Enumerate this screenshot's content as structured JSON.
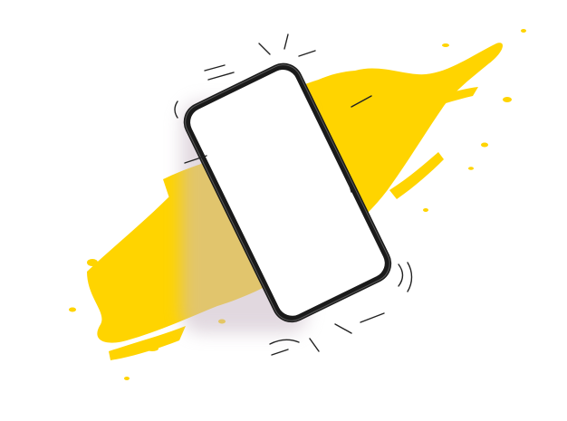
{
  "colors": {
    "background": "#ffffff",
    "splash": "#FFD400",
    "phone_frame": "#1a1a1a",
    "phone_screen": "#ffffff",
    "motion_lines": "#222222",
    "shadow": "#c9b9c6"
  },
  "icons": {
    "splash": "yellow-paint-brush-stroke",
    "device": "smartphone-blank-screen",
    "motion": "vibration-motion-lines"
  }
}
